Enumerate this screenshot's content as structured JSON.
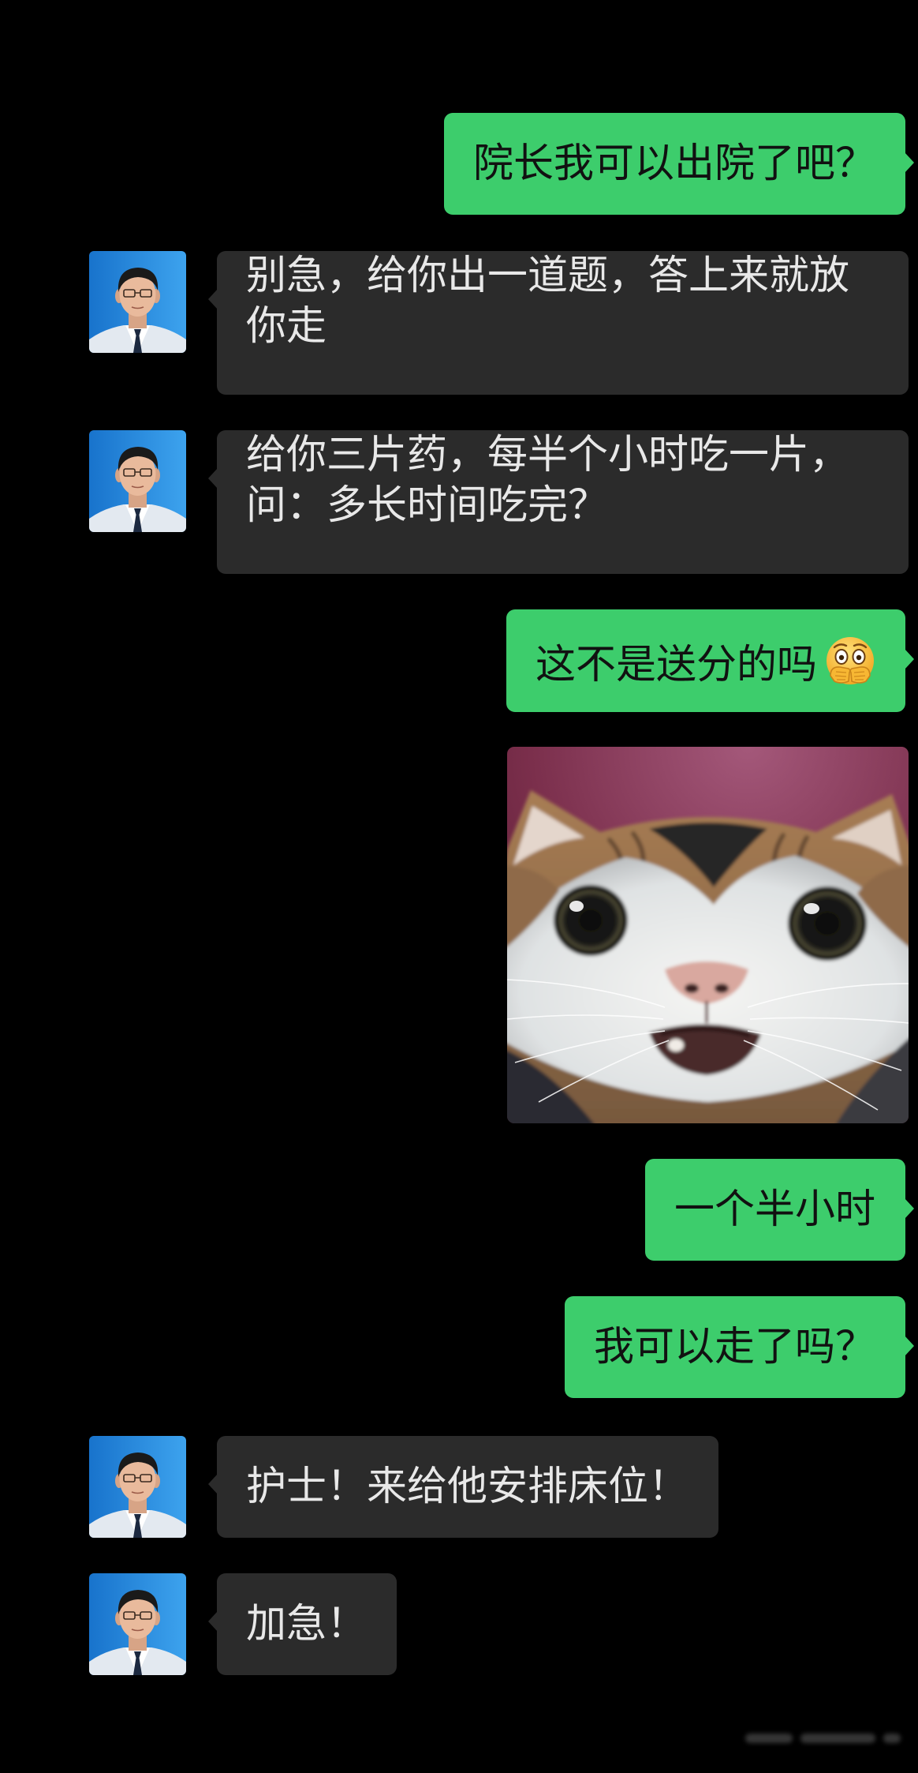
{
  "colors": {
    "background": "#000000",
    "outgoing_bubble": "#3dcd6c",
    "outgoing_text": "#111111",
    "incoming_bubble": "#2b2b2b",
    "incoming_text": "#e8e8e8"
  },
  "contact": {
    "avatar_icon": "contact-avatar-icon"
  },
  "messages": [
    {
      "outgoing": true,
      "text": "院长我可以出院了吧？"
    },
    {
      "outgoing": false,
      "lines": [
        "别急，给你出一道题，答上来就放",
        "你走"
      ]
    },
    {
      "outgoing": false,
      "lines": [
        "给你三片药，每半个小时吃一片，",
        "问：多长时间吃完？"
      ]
    },
    {
      "outgoing": true,
      "text": "这不是送分的吗",
      "emoji_icon": "hands-over-mouth-emoji-icon"
    },
    {
      "outgoing": true,
      "image_icon": "cat-face-image"
    },
    {
      "outgoing": true,
      "text": "一个半小时"
    },
    {
      "outgoing": true,
      "text": "我可以走了吗？"
    },
    {
      "outgoing": false,
      "text": "护士！来给他安排床位！"
    },
    {
      "outgoing": false,
      "text": "加急！"
    }
  ]
}
